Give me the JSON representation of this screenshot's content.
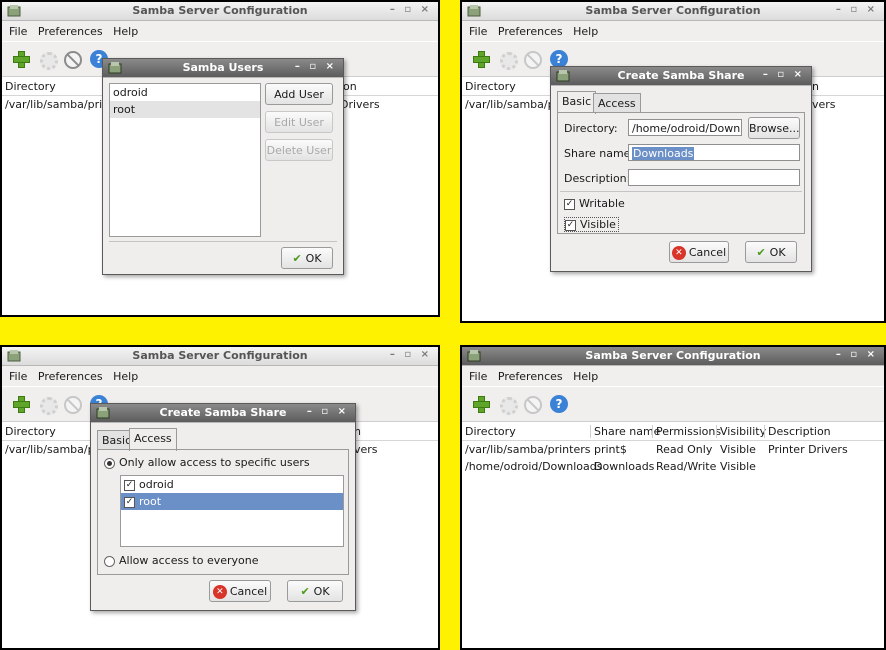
{
  "main_window": {
    "title": "Samba Server Configuration",
    "window_controls": "– ▫ ×",
    "menu": [
      "File",
      "Preferences",
      "Help"
    ],
    "toolbar_help_glyph": "?",
    "columns": [
      "Directory",
      "Share name",
      "Permissions",
      "Visibility",
      "Description"
    ],
    "rows_initial": [
      {
        "directory": "/var/lib/samba/printers",
        "share_name": "print$",
        "permissions": "Read Only",
        "visibility": "Visible",
        "description": "Printer Drivers"
      }
    ],
    "rows_final": [
      {
        "directory": "/var/lib/samba/printers",
        "share_name": "print$",
        "permissions": "Read Only",
        "visibility": "Visible",
        "description": "Printer Drivers"
      },
      {
        "directory": "/home/odroid/Downloads",
        "share_name": "Downloads",
        "permissions": "Read/Write",
        "visibility": "Visible",
        "description": ""
      }
    ],
    "truncated": {
      "dir_q1": "/var/lib/samba/prin",
      "dir_q2": "/var/lib/samba/pi",
      "dir_q3": "/var/lib/samba/pi",
      "col_q1": "ion",
      "cell_q1": "Drivers",
      "col_q2": "n",
      "cell_q2": "vers",
      "col_q3": "n",
      "cell_q3": "vers"
    }
  },
  "users_dialog": {
    "title": "Samba Users",
    "users": [
      "odroid",
      "root"
    ],
    "add_button": "Add User",
    "edit_button": "Edit User",
    "delete_button": "Delete User",
    "ok_button": "OK"
  },
  "create_share_basic": {
    "title": "Create Samba Share",
    "tabs": [
      "Basic",
      "Access"
    ],
    "directory_label": "Directory:",
    "directory_value": "/home/odroid/Downloa",
    "browse_button": "Browse...",
    "share_name_label": "Share name:",
    "share_name_value": "Downloads",
    "description_label": "Description:",
    "description_value": "",
    "writable_label": "Writable",
    "visible_label": "Visible",
    "cancel_button": "Cancel",
    "ok_button": "OK"
  },
  "create_share_access": {
    "title": "Create Samba Share",
    "tabs": [
      "Basic",
      "Access"
    ],
    "specific_users_label": "Only allow access to specific users",
    "users": [
      "odroid",
      "root"
    ],
    "everyone_label": "Allow access to everyone",
    "cancel_button": "Cancel",
    "ok_button": "OK"
  },
  "colors": {
    "background": "#fff200",
    "selection": "#6b8fc7",
    "active_title": "#5c5c5c"
  }
}
